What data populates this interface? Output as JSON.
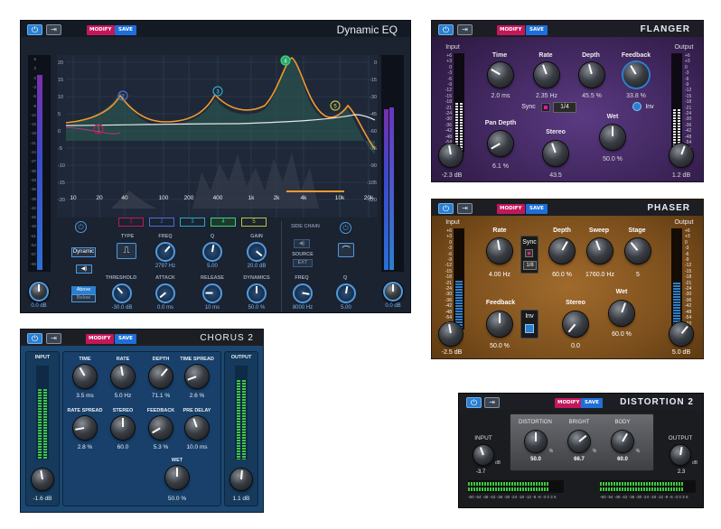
{
  "dynamic_eq": {
    "title": "Dynamic EQ",
    "modify": "MODIFY",
    "save": "SAVE",
    "db_left": [
      "20",
      "15",
      "10",
      "5",
      "0",
      "-5",
      "-10",
      "-15",
      "-20"
    ],
    "db_right": [
      "0",
      "-15",
      "-30",
      "-45",
      "-60",
      "-75",
      "-90",
      "-105",
      "-120"
    ],
    "freq_labels": [
      "10",
      "20",
      "40",
      "100",
      "200",
      "400",
      "1k",
      "2k",
      "4k",
      "10k",
      "20k"
    ],
    "meter_scale": [
      "6",
      "3",
      "0",
      "-3",
      "-6",
      "-9",
      "-12",
      "-15",
      "-18",
      "-21",
      "-24",
      "-27",
      "-30",
      "-33",
      "-36",
      "-39",
      "-42",
      "-45",
      "-48",
      "-51",
      "-54",
      "-57",
      "-60"
    ],
    "bands": [
      "1",
      "2",
      "3",
      "4",
      "5"
    ],
    "labels": {
      "type": "TYPE",
      "freq": "FREQ",
      "q": "Q",
      "gain": "GAIN",
      "threshold": "THRESHOLD",
      "attack": "ATTACK",
      "release": "RELEASE",
      "dynamics": "DYNAMICS",
      "side_chain": "SIDE CHAIN",
      "source": "SOURCE",
      "ext": "EXT",
      "sc_freq": "FREQ",
      "sc_q": "Q",
      "dynamic": "Dynamic",
      "above": "Above",
      "below": "Below"
    },
    "values": {
      "freq": "2797 Hz",
      "q": "5.00",
      "gain": "20.0 dB",
      "threshold": "-30.0 dB",
      "attack": "0.0 ms",
      "release": "10 ms",
      "dynamics": "50.0 %",
      "sc_freq": "8000 Hz",
      "sc_q": "5.00",
      "input": "0.0 dB",
      "output": "0.0 dB"
    },
    "band_markers": [
      "1",
      "2",
      "3",
      "4",
      "5"
    ]
  },
  "flanger": {
    "title": "FLANGER",
    "modify": "MODIFY",
    "save": "SAVE",
    "input": "Input",
    "output": "Output",
    "meter_scale": [
      "+6",
      "+3",
      "0",
      "-3",
      "-6",
      "-9",
      "-12",
      "-15",
      "-18",
      "-21",
      "-24",
      "-30",
      "-36",
      "-42",
      "-48",
      "-54",
      "-60"
    ],
    "time": {
      "label": "Time",
      "value": "2.0 ms"
    },
    "rate": {
      "label": "Rate",
      "value": "2.35 Hz"
    },
    "depth": {
      "label": "Depth",
      "value": "45.5 %"
    },
    "feedback": {
      "label": "Feedback",
      "value": "33.8 %"
    },
    "sync": "Sync",
    "sync_value": "1/4",
    "inv": "Inv",
    "pan_depth": {
      "label": "Pan Depth",
      "value": "6.1 %"
    },
    "stereo": {
      "label": "Stereo",
      "value": "43.5"
    },
    "wet": {
      "label": "Wet",
      "value": "50.0 %"
    },
    "in_value": "-2.3 dB",
    "out_value": "1.2 dB"
  },
  "phaser": {
    "title": "PHASER",
    "modify": "MODIFY",
    "save": "SAVE",
    "input": "Input",
    "output": "Output",
    "meter_scale": [
      "+6",
      "+3",
      "0",
      "-3",
      "-6",
      "-9",
      "-12",
      "-15",
      "-18",
      "-21",
      "-24",
      "-30",
      "-36",
      "-42",
      "-48",
      "-54",
      "-60"
    ],
    "rate": {
      "label": "Rate",
      "value": "4.00 Hz"
    },
    "sync": "Sync",
    "sync_value": "1/8",
    "depth": {
      "label": "Depth",
      "value": "60.0 %"
    },
    "sweep": {
      "label": "Sweep",
      "value": "1760.0 Hz"
    },
    "stage": {
      "label": "Stage",
      "value": "5"
    },
    "feedback": {
      "label": "Feedback",
      "value": "50.0 %"
    },
    "inv": "Inv",
    "stereo": {
      "label": "Stereo",
      "value": "0.0"
    },
    "wet": {
      "label": "Wet",
      "value": "60.0 %"
    },
    "in_value": "-2.5 dB",
    "out_value": "5.0 dB"
  },
  "chorus": {
    "title": "CHORUS 2",
    "modify": "MODIFY",
    "save": "SAVE",
    "input": "INPUT",
    "output": "OUTPUT",
    "knobs": [
      {
        "label": "TIME",
        "value": "3.5 ms"
      },
      {
        "label": "RATE",
        "value": "5.0 Hz"
      },
      {
        "label": "DEPTH",
        "value": "71.1 %"
      },
      {
        "label": "TIME SPREAD",
        "value": "2.6 %"
      },
      {
        "label": "RATE SPREAD",
        "value": "2.8 %"
      },
      {
        "label": "STEREO",
        "value": "60.0"
      },
      {
        "label": "FEEDBACK",
        "value": "5.3 %"
      },
      {
        "label": "PRE DELAY",
        "value": "10.0 ms"
      }
    ],
    "wet": {
      "label": "WET",
      "value": "50.0 %"
    },
    "in_value": "-1.6 dB",
    "out_value": "1.1 dB"
  },
  "distortion": {
    "title": "DISTORTION 2",
    "modify": "MODIFY",
    "save": "SAVE",
    "input": "INPUT",
    "output": "OUTPUT",
    "distortion": {
      "label": "DISTORTION",
      "value": "50.0"
    },
    "bright": {
      "label": "BRIGHT",
      "value": "66.7"
    },
    "body": {
      "label": "BODY",
      "value": "60.0"
    },
    "in_value": "-3.7",
    "out_value": "2.3",
    "db": "dB",
    "pct": "%",
    "scale": "-60 -54 -48 -42 -36 -30 -24 -18 -12 -9 -6 -3 0 3 6"
  },
  "colors": {
    "accent": "#2b7fd0",
    "modify": "#c2185b",
    "save": "#1e6fd9",
    "eq_curve": "#f39a2c",
    "flanger_bg": "#4a2a6e",
    "phaser_bg": "#8a5a22",
    "chorus_bg": "#1c4770"
  }
}
